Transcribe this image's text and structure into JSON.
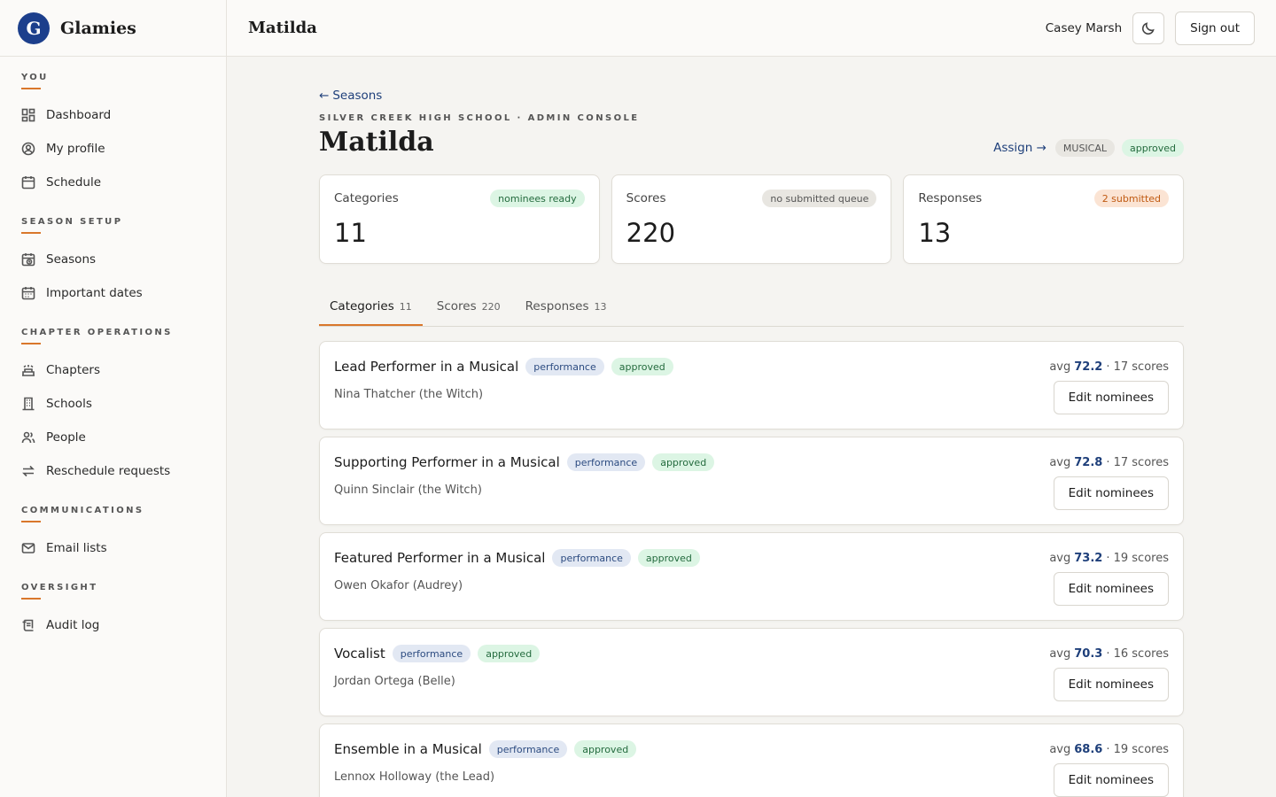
{
  "brand": {
    "name": "Glamies",
    "logo_letter": "G"
  },
  "header": {
    "title": "Matilda",
    "user_name": "Casey Marsh",
    "sign_out": "Sign out"
  },
  "nav": [
    {
      "heading": "YOU",
      "items": [
        {
          "label": "Dashboard",
          "icon": "dashboard-icon"
        },
        {
          "label": "My profile",
          "icon": "profile-icon"
        },
        {
          "label": "Schedule",
          "icon": "calendar-icon"
        }
      ]
    },
    {
      "heading": "SEASON SETUP",
      "items": [
        {
          "label": "Seasons",
          "icon": "calendar-clock-icon"
        },
        {
          "label": "Important dates",
          "icon": "calendar-icon"
        }
      ]
    },
    {
      "heading": "CHAPTER OPERATIONS",
      "items": [
        {
          "label": "Chapters",
          "icon": "chapters-icon"
        },
        {
          "label": "Schools",
          "icon": "school-icon"
        },
        {
          "label": "People",
          "icon": "people-icon"
        },
        {
          "label": "Reschedule requests",
          "icon": "swap-icon"
        }
      ]
    },
    {
      "heading": "COMMUNICATIONS",
      "items": [
        {
          "label": "Email lists",
          "icon": "mail-icon"
        }
      ]
    },
    {
      "heading": "OVERSIGHT",
      "items": [
        {
          "label": "Audit log",
          "icon": "audit-log-icon"
        }
      ]
    }
  ],
  "page": {
    "back_label": "Seasons",
    "eyebrow": "SILVER CREEK HIGH SCHOOL · ADMIN CONSOLE",
    "title": "Matilda",
    "assign_label": "Assign →",
    "type_badge": "MUSICAL",
    "status_badge": "approved"
  },
  "stats": [
    {
      "label": "Categories",
      "badge": "nominees ready",
      "value": "11"
    },
    {
      "label": "Scores",
      "badge": "no submitted queue",
      "value": "220"
    },
    {
      "label": "Responses",
      "badge": "2 submitted",
      "value": "13"
    }
  ],
  "tabs": [
    {
      "label": "Categories",
      "count": "11"
    },
    {
      "label": "Scores",
      "count": "220"
    },
    {
      "label": "Responses",
      "count": "13"
    }
  ],
  "categories": [
    {
      "title": "Lead Performer in a Musical",
      "tag": "performance",
      "status": "approved",
      "nominee": "Nina Thatcher (the Witch)",
      "avg_prefix": "avg",
      "avg": "72.2",
      "scores": "· 17 scores",
      "button": "Edit nominees"
    },
    {
      "title": "Supporting Performer in a Musical",
      "tag": "performance",
      "status": "approved",
      "nominee": "Quinn Sinclair (the Witch)",
      "avg_prefix": "avg",
      "avg": "72.8",
      "scores": "· 17 scores",
      "button": "Edit nominees"
    },
    {
      "title": "Featured Performer in a Musical",
      "tag": "performance",
      "status": "approved",
      "nominee": "Owen Okafor (Audrey)",
      "avg_prefix": "avg",
      "avg": "73.2",
      "scores": "· 19 scores",
      "button": "Edit nominees"
    },
    {
      "title": "Vocalist",
      "tag": "performance",
      "status": "approved",
      "nominee": "Jordan Ortega (Belle)",
      "avg_prefix": "avg",
      "avg": "70.3",
      "scores": "· 16 scores",
      "button": "Edit nominees"
    },
    {
      "title": "Ensemble in a Musical",
      "tag": "performance",
      "status": "approved",
      "nominee": "Lennox Holloway (the Lead)",
      "avg_prefix": "avg",
      "avg": "68.6",
      "scores": "· 19 scores",
      "button": "Edit nominees"
    }
  ]
}
